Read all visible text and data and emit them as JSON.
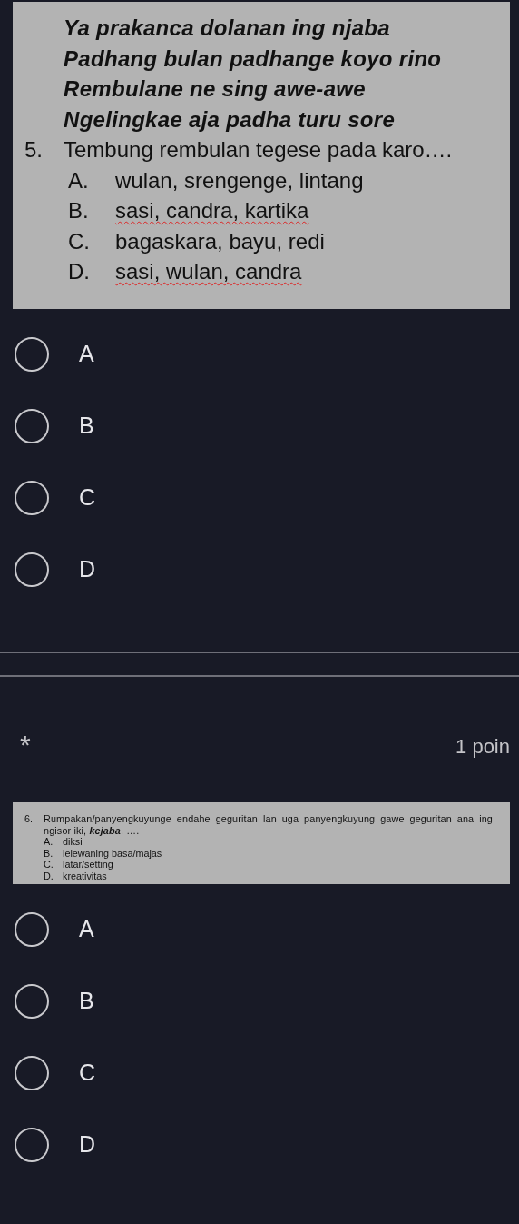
{
  "question_5": {
    "image": {
      "verse": [
        "Ya prakanca dolanan ing njaba",
        "Padhang bulan padhange koyo rino",
        "Rembulane ne sing awe-awe",
        "Ngelingkae aja padha turu sore"
      ],
      "number": "5.",
      "prompt": "Tembung rembulan tegese pada karo….",
      "options": [
        {
          "letter": "A.",
          "text": "wulan, srengenge,  lintang",
          "misspelled": false
        },
        {
          "letter": "B.",
          "text": "sasi, candra, kartika",
          "misspelled": true
        },
        {
          "letter": "C.",
          "text": "bagaskara, bayu, redi",
          "misspelled": false
        },
        {
          "letter": "D.",
          "text": "sasi, wulan,  candra",
          "misspelled": true
        }
      ]
    },
    "choices": [
      {
        "label": "A",
        "selected": false
      },
      {
        "label": "B",
        "selected": false
      },
      {
        "label": "C",
        "selected": false
      },
      {
        "label": "D",
        "selected": false
      }
    ]
  },
  "question_6": {
    "required_mark": "*",
    "points": "1 poin",
    "image": {
      "number": "6.",
      "prompt": "Rumpakan/panyengkuyunge endahe geguritan lan uga panyengkuyung gawe geguritan ana ing ngisor iki, **kejaba**, ….",
      "options": [
        {
          "letter": "A.",
          "text": "diksi"
        },
        {
          "letter": "B.",
          "text": "lelewaning basa/majas"
        },
        {
          "letter": "C.",
          "text": "latar/setting"
        },
        {
          "letter": "D.",
          "text": "kreativitas"
        }
      ]
    },
    "choices": [
      {
        "label": "A",
        "selected": false
      },
      {
        "label": "B",
        "selected": false
      },
      {
        "label": "C",
        "selected": false
      },
      {
        "label": "D",
        "selected": false
      }
    ]
  }
}
